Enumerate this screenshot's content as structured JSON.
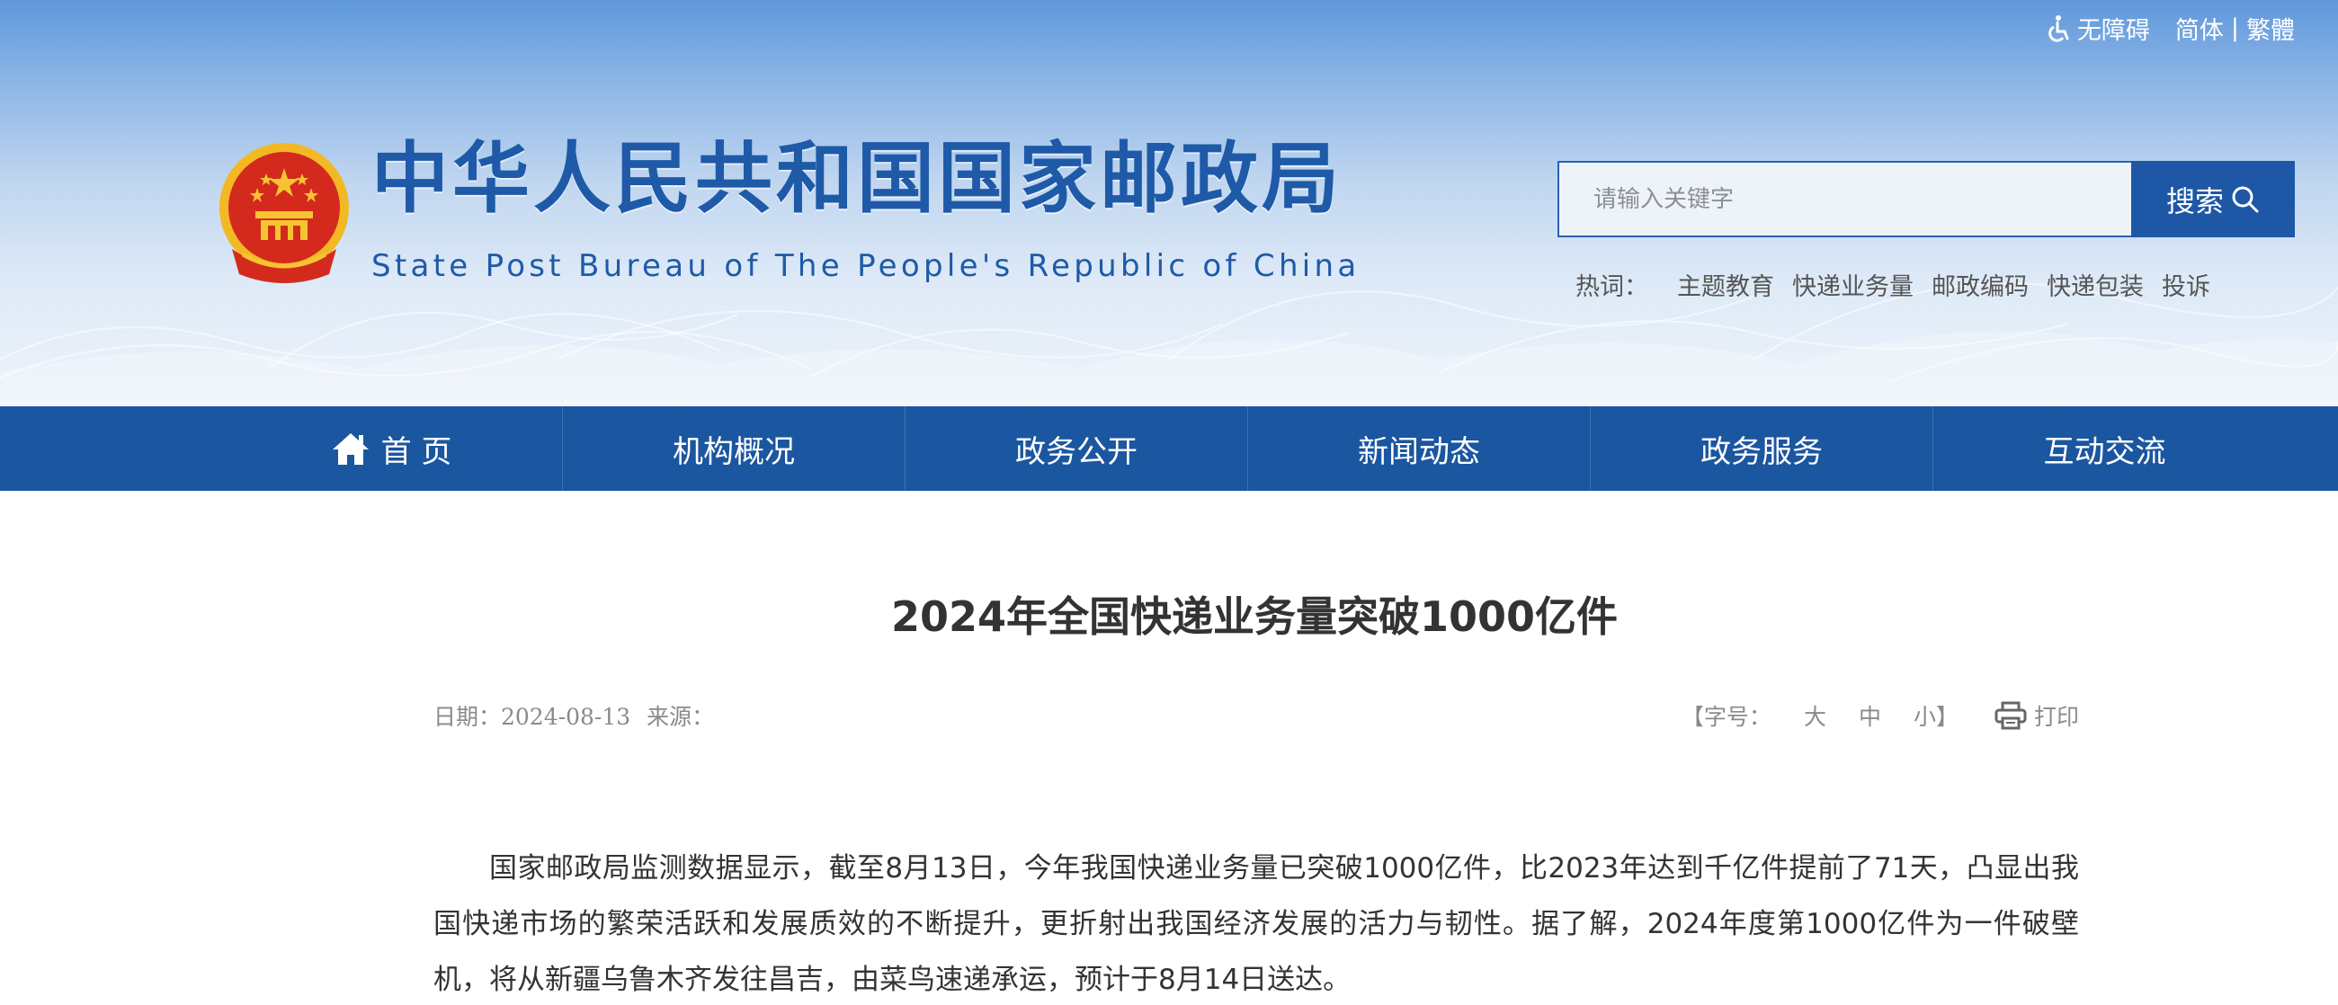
{
  "topbar": {
    "accessibility_label": "无障碍",
    "simplified_label": "简体",
    "separator": "|",
    "traditional_label": "繁體"
  },
  "site": {
    "title": "中华人民共和国国家邮政局",
    "subtitle": "State Post Bureau of The People's Republic of China"
  },
  "search": {
    "placeholder": "请输入关键字",
    "button_label": "搜索"
  },
  "hotwords": {
    "label": "热词：",
    "items": [
      "主题教育",
      "快递业务量",
      "邮政编码",
      "快递包装",
      "投诉"
    ]
  },
  "nav": {
    "items": [
      {
        "label": "首 页"
      },
      {
        "label": "机构概况"
      },
      {
        "label": "政务公开"
      },
      {
        "label": "新闻动态"
      },
      {
        "label": "政务服务"
      },
      {
        "label": "互动交流"
      }
    ]
  },
  "article": {
    "title": "2024年全国快递业务量突破1000亿件",
    "date_label": "日期：2024-08-13",
    "source_label": "来源：",
    "font_size_label": "【字号：",
    "font_large": "大",
    "font_medium": "中",
    "font_small": "小】",
    "print_label": "打印",
    "body": "国家邮政局监测数据显示，截至8月13日，今年我国快递业务量已突破1000亿件，比2023年达到千亿件提前了71天，凸显出我国快递市场的繁荣活跃和发展质效的不断提升，更折射出我国经济发展的活力与韧性。据了解，2024年度第1000亿件为一件破壁机，将从新疆乌鲁木齐发往昌吉，由菜鸟速递承运，预计于8月14日送达。"
  },
  "colors": {
    "brand_blue": "#1e5aa8",
    "nav_blue": "#1b56a0",
    "search_button": "#1e57a6",
    "emblem_red": "#d42a1e",
    "emblem_gold": "#f5c431"
  },
  "icons": {
    "accessibility": "wheelchair-icon",
    "search": "magnifier-icon",
    "home": "home-icon",
    "print": "printer-icon",
    "emblem": "national-emblem"
  }
}
